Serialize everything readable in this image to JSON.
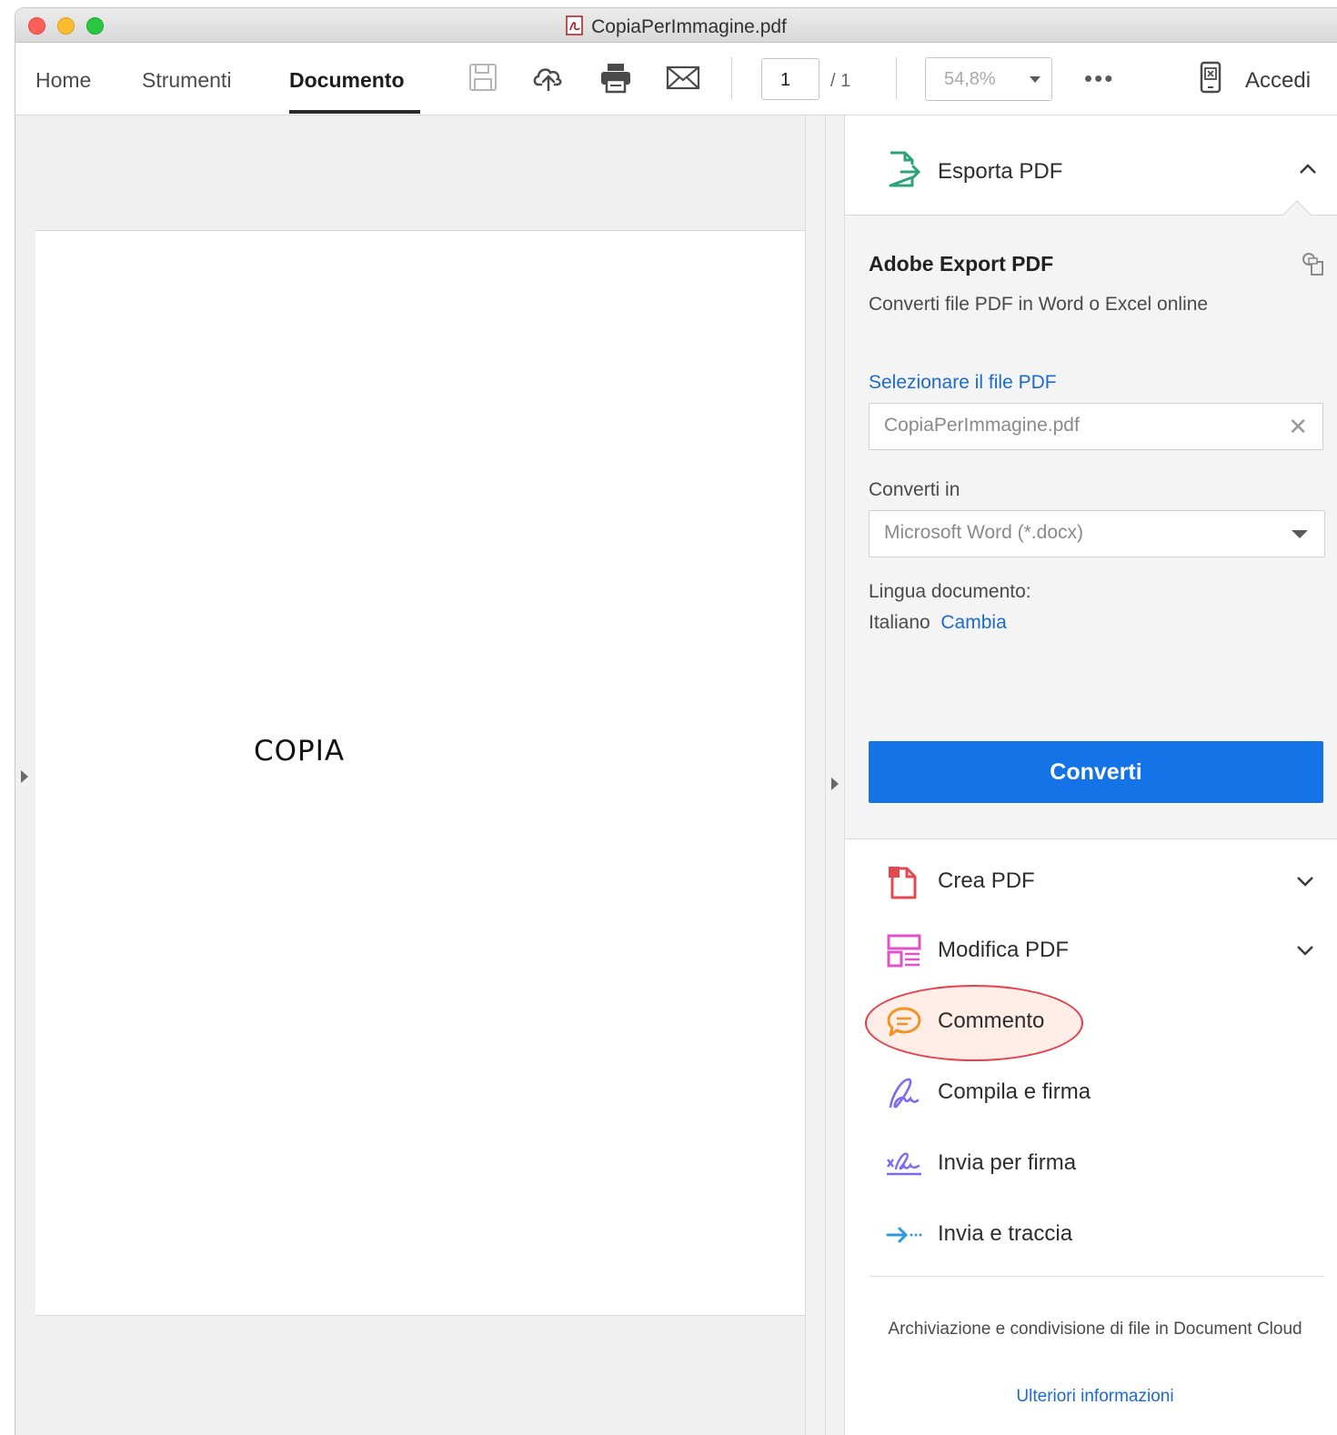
{
  "window": {
    "title": "CopiaPerImmagine.pdf"
  },
  "toolbar": {
    "tabs": [
      {
        "label": "Home"
      },
      {
        "label": "Strumenti"
      },
      {
        "label": "Documento"
      }
    ],
    "page_current": "1",
    "page_total": "/ 1",
    "zoom": "54,8%",
    "more": "•••",
    "signin_label": "Accedi",
    "icons": [
      "save-icon",
      "upload-cloud-icon",
      "print-icon",
      "mail-icon",
      "mobile-link-icon"
    ]
  },
  "document": {
    "page_text": "COPIA"
  },
  "panel": {
    "export": {
      "header_label": "Esporta PDF",
      "title": "Adobe Export PDF",
      "subtitle": "Converti file PDF in Word o Excel online",
      "select_label": "Selezionare il file PDF",
      "file_name": "CopiaPerImmagine.pdf",
      "convert_to_label": "Converti in",
      "convert_to_value": "Microsoft Word (*.docx)",
      "language_label": "Lingua documento:",
      "language_value": "Italiano",
      "language_change": "Cambia",
      "convert_button": "Converti"
    },
    "tools": [
      {
        "label": "Crea PDF",
        "icon": "create-pdf-icon"
      },
      {
        "label": "Modifica PDF",
        "icon": "edit-pdf-icon"
      },
      {
        "label": "Commento",
        "icon": "comment-icon"
      },
      {
        "label": "Compila e firma",
        "icon": "fill-sign-icon"
      },
      {
        "label": "Invia per firma",
        "icon": "send-signature-icon"
      },
      {
        "label": "Invia e traccia",
        "icon": "send-track-icon"
      }
    ],
    "footer_text": "Archiviazione e condivisione di file in Document Cloud",
    "footer_link": "Ulteriori informazioni"
  },
  "colors": {
    "accent": "#1473e6",
    "link": "#1c6bcc",
    "highlight": "#e63f4a"
  }
}
